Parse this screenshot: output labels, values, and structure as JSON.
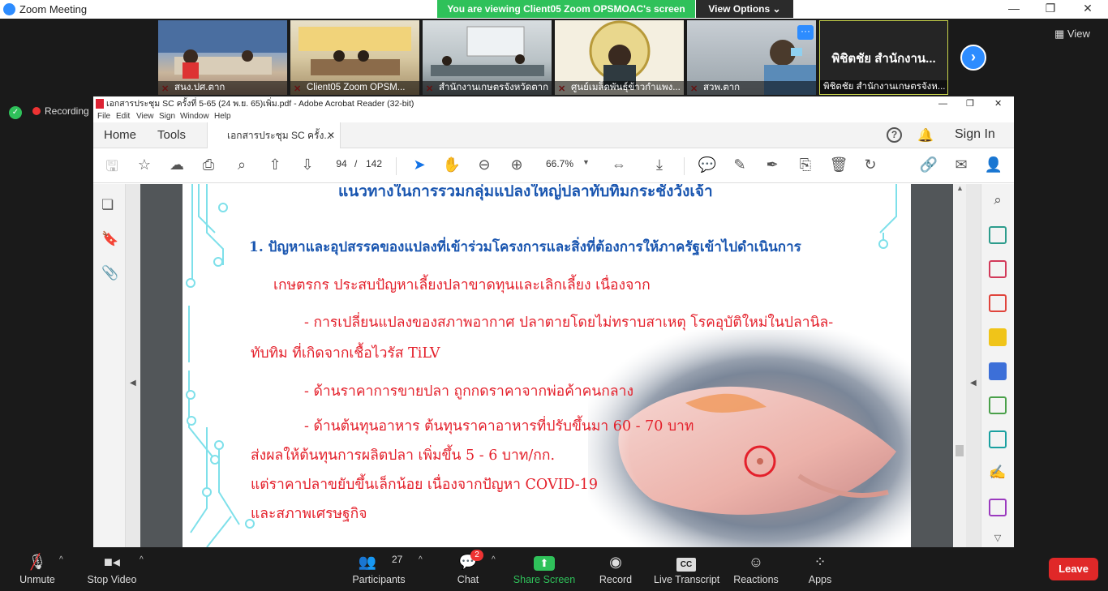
{
  "zoom": {
    "window_title": "Zoom Meeting",
    "viewing_banner": "You are viewing Client05 Zoom OPSMOAC's screen",
    "view_options": "View Options",
    "view_button": "View",
    "recording": "Recording",
    "participants_thumbs": [
      {
        "name": "สนง.ปศ.ตาก"
      },
      {
        "name": "Client05 Zoom OPSM..."
      },
      {
        "name": "สำนักงานเกษตรจังหวัดตาก"
      },
      {
        "name": "ศูนย์เมล็ดพันธุ์ข้าวกำแพง..."
      },
      {
        "name": "สวพ.ตาก"
      },
      {
        "name": "พิชิตชัย สำนักงานเกษตรจังห...",
        "big": "พิชิตชัย สำนักงาน..."
      }
    ],
    "toolbar": {
      "unmute": "Unmute",
      "stop_video": "Stop Video",
      "participants": "Participants",
      "participants_count": "27",
      "chat": "Chat",
      "chat_badge": "2",
      "share_screen": "Share Screen",
      "record": "Record",
      "live_transcript": "Live Transcript",
      "reactions": "Reactions",
      "apps": "Apps",
      "leave": "Leave"
    }
  },
  "acrobat": {
    "window_title": "เอกสารประชุม SC ครั้งที่ 5-65 (24 พ.ย. 65)เพิ่ม.pdf - Adobe Acrobat Reader (32-bit)",
    "menu": [
      "File",
      "Edit",
      "View",
      "Sign",
      "Window",
      "Help"
    ],
    "tabs": {
      "home": "Home",
      "tools": "Tools",
      "doc": "เอกสารประชุม SC ครั้ง...",
      "sign_in": "Sign In"
    },
    "page_current": "94",
    "page_sep": "/",
    "page_total": "142",
    "zoom": "66.7%"
  },
  "pdf_page": {
    "title": "แนวทางในการรวมกลุ่มแปลงใหญ่ปลาทับทิมกระชังวังเจ้า",
    "heading": "1.  ปัญหาและอุปสรรคของแปลงที่เข้าร่วมโครงการและสิ่งที่ต้องการให้ภาครัฐเข้าไปดำเนินการ",
    "lines": [
      "เกษตรกร ประสบปัญหาเลี้ยงปลาขาดทุนและเลิกเลี้ยง เนื่องจาก",
      "- การเปลี่ยนแปลงของสภาพอากาศ ปลาตายโดยไม่ทราบสาเหตุ โรคอุบัติใหม่ในปลานิล-",
      "ทับทิม ที่เกิดจากเชื้อไวรัส TiLV",
      "- ด้านราคาการขายปลา ถูกกดราคาจากพ่อค้าคนกลาง",
      "- ด้านต้นทุนอาหาร ต้นทุนราคาอาหารที่ปรับขึ้นมา 60 - 70 บาท",
      "ส่งผลให้ต้นทุนการผลิตปลา เพิ่มขึ้น 5 - 6 บาท/กก.",
      "แต่ราคาปลาขยับขึ้นเล็กน้อย เนื่องจากปัญหา COVID-19",
      "และสภาพเศรษฐกิจ"
    ]
  }
}
